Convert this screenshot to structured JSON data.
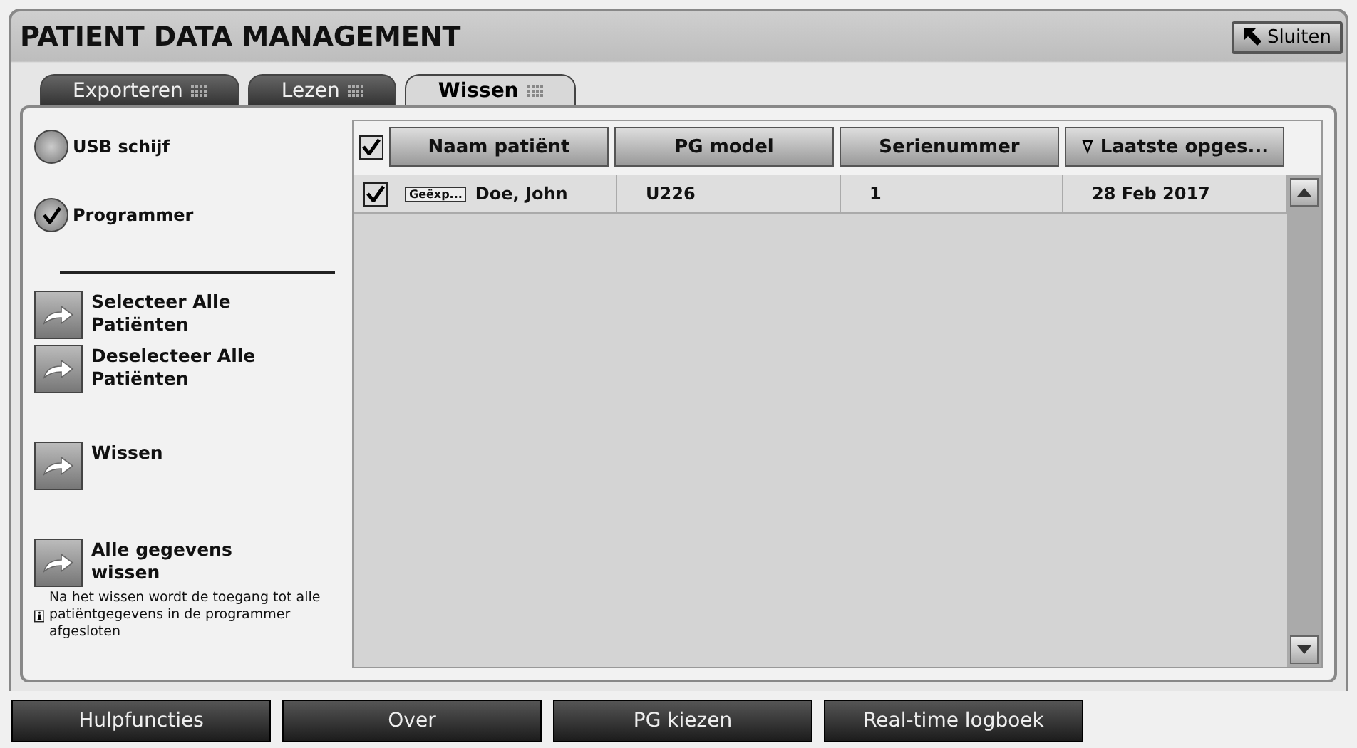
{
  "window": {
    "title": "PATIENT DATA MANAGEMENT",
    "close_button": "Sluiten"
  },
  "tabs": [
    {
      "label": "Exporteren",
      "selected": false
    },
    {
      "label": "Lezen",
      "selected": false
    },
    {
      "label": "Wissen",
      "selected": true
    }
  ],
  "sources": [
    {
      "label": "USB schijf",
      "selected": false
    },
    {
      "label": "Programmer",
      "selected": true
    }
  ],
  "action_groups": [
    [
      "Selecteer Alle Patiënten",
      "Deselecteer Alle Patiënten"
    ],
    [
      "Wissen"
    ],
    [
      "Alle gegevens wissen"
    ]
  ],
  "note": "Na het wissen wordt de toegang tot alle patiëntgegevens in de programmer afgesloten",
  "table": {
    "all_checked": true,
    "columns": [
      {
        "label": "Naam patiënt",
        "sorted": false
      },
      {
        "label": "PG model",
        "sorted": false
      },
      {
        "label": "Serienummer",
        "sorted": false
      },
      {
        "label": "Laatste opges...",
        "sorted": true
      }
    ],
    "rows": [
      {
        "checked": true,
        "tag": "Geëxp...",
        "cells": [
          "Doe, John",
          "U226",
          "1",
          "28 Feb 2017"
        ]
      }
    ]
  },
  "bottom_buttons": [
    "Hulpfuncties",
    "Over",
    "PG kiezen",
    "Real-time logboek"
  ]
}
